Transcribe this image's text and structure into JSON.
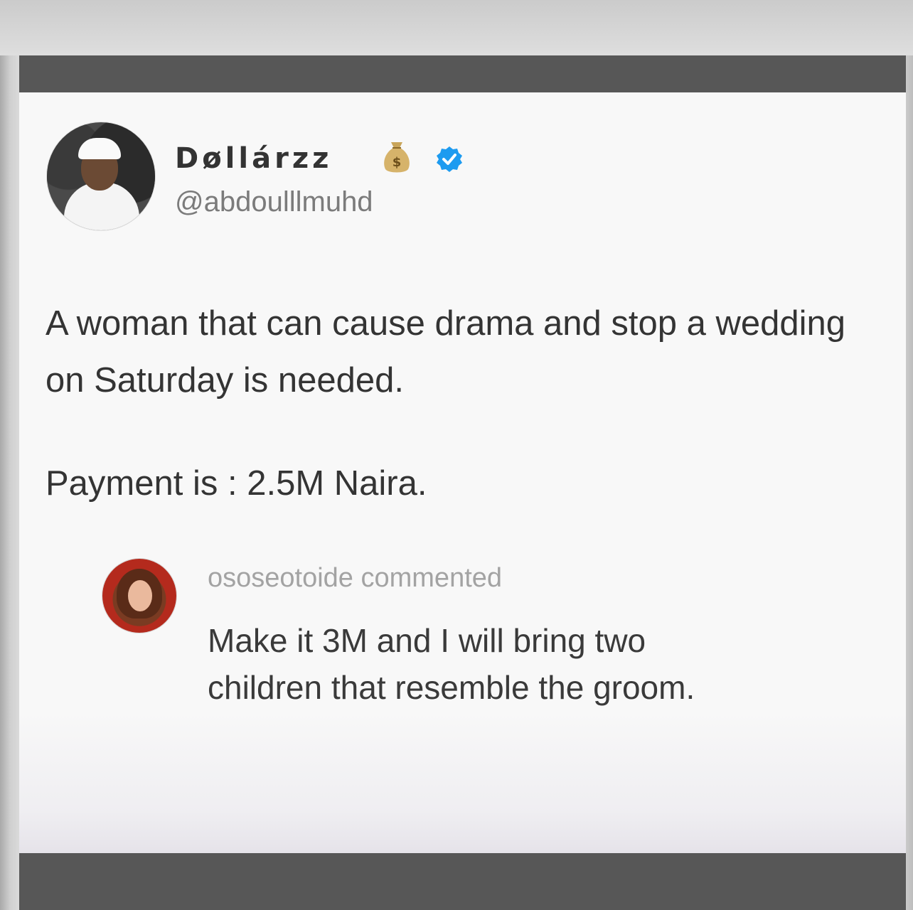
{
  "post": {
    "author": {
      "display_name": "Døllárzz",
      "handle": "@abdoulllmuhd",
      "badges": [
        "money-bag-icon",
        "verified-badge-icon"
      ]
    },
    "text_line_1": "A woman that can cause drama and stop a wedding on Saturday is needed.",
    "text_line_2": "Payment is : 2.5M Naira."
  },
  "comment": {
    "meta": "ososeotoide commented",
    "text": "Make it 3M and I will bring two children that resemble the groom."
  },
  "colors": {
    "verified_blue": "#1d9bf0",
    "frame_bar": "#575757",
    "card_bg": "#f8f8f8"
  }
}
